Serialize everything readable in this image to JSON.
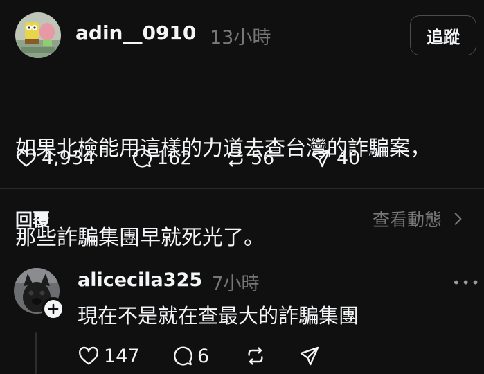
{
  "post": {
    "username": "adin__0910",
    "time": "13小時",
    "follow_label": "追蹤",
    "text_line1": "如果北檢能用這樣的力道去查台灣的詐騙案，",
    "text_line2": "那些詐騙集團早就死光了。",
    "likes": "4,934",
    "comments": "162",
    "reposts": "56",
    "shares": "40"
  },
  "reply_section": {
    "label": "回覆",
    "view_activity": "查看動態"
  },
  "reply": {
    "username": "alicecila325",
    "time": "7小時",
    "text": "現在不是就在查最大的詐騙集團",
    "likes": "147",
    "comments": "6",
    "more": "•••"
  },
  "icons": {
    "like": "heart-icon",
    "comment": "comment-bubble-icon",
    "repost": "repost-icon",
    "share": "send-icon",
    "chevron": "chevron-right-icon",
    "plus": "plus-icon"
  },
  "colors": {
    "background": "#101010",
    "text": "#f3f5f7",
    "muted": "#777777",
    "divider": "#2a2a2a"
  }
}
